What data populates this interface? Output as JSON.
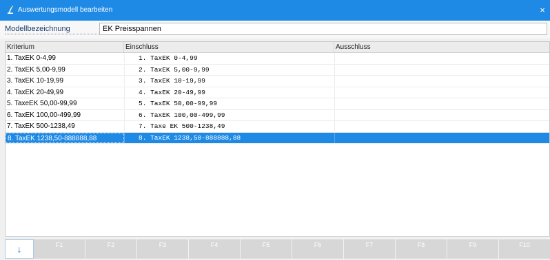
{
  "window": {
    "title": "Auswertungsmodell bearbeiten",
    "close_glyph": "×"
  },
  "icons": {
    "title": "app-icon",
    "close": "close-icon",
    "arrow": "arrow-down-icon"
  },
  "colors": {
    "titlebar": "#1e8ae6",
    "selection": "#1e8ae6",
    "fkey_bg": "#d7d7d7"
  },
  "form": {
    "label": "Modellbezeichnung",
    "value": "EK Preisspannen"
  },
  "table": {
    "columns": [
      "Kriterium",
      "Einschluss",
      "Ausschluss"
    ],
    "rows": [
      {
        "kriterium": "1. TaxEK 0-4,99",
        "einschluss": "1. TaxEK 0-4,99",
        "ausschluss": ""
      },
      {
        "kriterium": "2. TaxEK 5,00-9,99",
        "einschluss": "2. TaxEK 5,00-9,99",
        "ausschluss": ""
      },
      {
        "kriterium": "3. TaxEK 10-19,99",
        "einschluss": "3. TaxEK 10-19,99",
        "ausschluss": ""
      },
      {
        "kriterium": "4. TaxEK 20-49,99",
        "einschluss": "4. TaxEK 20-49,99",
        "ausschluss": ""
      },
      {
        "kriterium": "5. TaxeEK 50,00-99,99",
        "einschluss": "5. TaxEK 50,00-99,99",
        "ausschluss": ""
      },
      {
        "kriterium": "6. TaxEK 100,00-499,99",
        "einschluss": "6. TaxEK 100,00-499,99",
        "ausschluss": ""
      },
      {
        "kriterium": "7. TaxEK 500-1238,49",
        "einschluss": "7. Taxe EK 500-1238,49",
        "ausschluss": ""
      },
      {
        "kriterium": "8. TaxEK 1238,50-888888,88",
        "einschluss": "8. TaxEK 1238,50-888888,88",
        "ausschluss": ""
      }
    ],
    "selected_row": 8
  },
  "function_keys": {
    "arrow_glyph": "↓",
    "keys": [
      "F1",
      "F2",
      "F3",
      "F4",
      "F5",
      "F6",
      "F7",
      "F8",
      "F9",
      "F10"
    ]
  }
}
